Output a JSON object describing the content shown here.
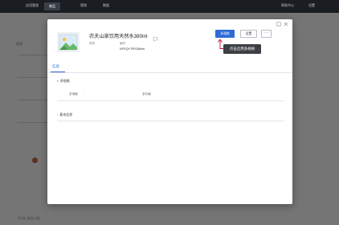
{
  "app": {
    "nav": [
      "应用管理",
      "商品",
      "营销",
      "数据"
    ],
    "right_links": [
      "帮助中心",
      "设置"
    ]
  },
  "background": {
    "list_header": "规格",
    "footer": "共5条  每页20条"
  },
  "modal": {
    "product_title": "农夫山泉饮用天然水380ml",
    "meta": [
      {
        "label": "类别",
        "value": ""
      },
      {
        "label": "编号",
        "value": "NFSQYTRS380ml"
      }
    ],
    "actions": {
      "primary": "多规格",
      "secondary": "设置",
      "more": "···"
    },
    "tooltip": "点击启用多规格",
    "tabs": [
      "信息"
    ],
    "sections": [
      {
        "title": "多规格",
        "fields": [
          {
            "label": "多规格",
            "value": "-"
          },
          {
            "label": "多价格",
            "value": "-"
          }
        ]
      },
      {
        "title": "基本信息",
        "fields": []
      }
    ],
    "colors": {
      "primary": "#2e6bd6",
      "tooltip_bg": "#3c3f44",
      "arrow": "#c0143c"
    },
    "icons": {
      "window_restore": "square-icon",
      "window_close": "close-icon",
      "comment": "comment-icon",
      "thumbnail": "image-icon"
    }
  }
}
